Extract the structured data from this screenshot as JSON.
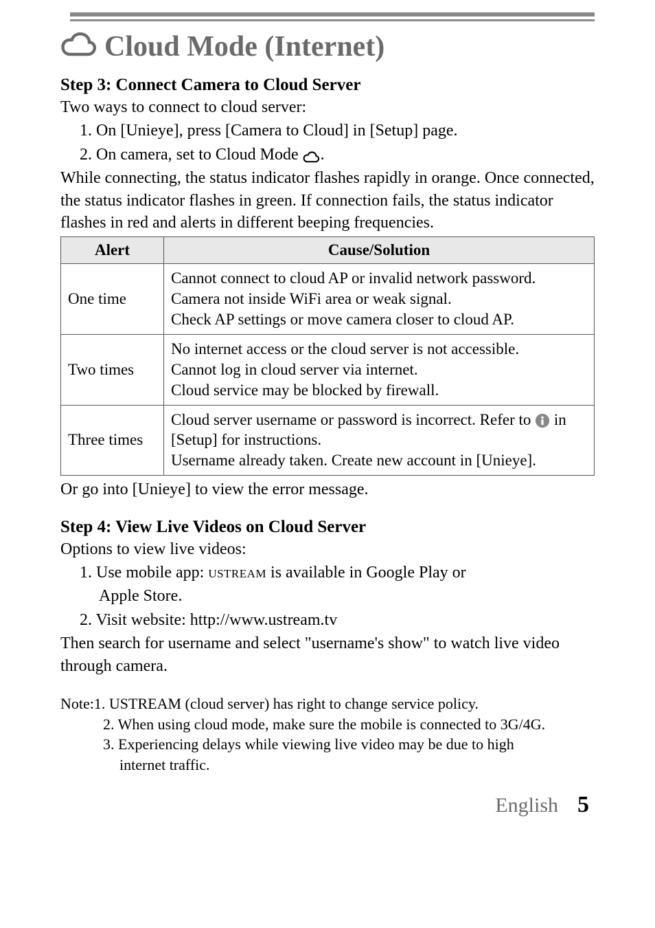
{
  "title": "Cloud Mode (Internet)",
  "step3": {
    "heading": "Step 3: Connect Camera to Cloud Server",
    "intro": "Two ways to connect to cloud server:",
    "item1": "1. On [Unieye], press [Camera to Cloud] in [Setup] page.",
    "item2_pre": "2. On camera, set to Cloud Mode ",
    "item2_post": ".",
    "para": "While connecting, the status indicator flashes rapidly in orange. Once connected, the status indicator flashes in green. If connection fails, the status indicator flashes in red and alerts in different beeping frequencies.",
    "table": {
      "headers": [
        "Alert",
        "Cause/Solution"
      ],
      "rows": [
        {
          "alert": "One time",
          "cause": "Cannot connect to cloud AP or invalid network password.\nCamera not inside WiFi area or weak signal.\nCheck AP settings or move camera closer to cloud AP."
        },
        {
          "alert": "Two times",
          "cause": "No internet access or the cloud server is not accessible.\nCannot log in cloud server via internet.\nCloud service may be blocked by firewall."
        },
        {
          "alert": "Three times",
          "cause_pre": "Cloud server username or password is incorrect. Refer to ",
          "cause_post": " in [Setup] for instructions.\nUsername already taken. Create new account in [Unieye]."
        }
      ]
    },
    "after_table": "Or go into [Unieye] to view the error message."
  },
  "step4": {
    "heading": "Step 4: View Live Videos on Cloud Server",
    "intro": "Options to view live videos:",
    "item1_pre": "1. Use mobile app: ",
    "item1_brand": "ustream",
    "item1_post": " is available in Google Play or",
    "item1_line2": "Apple Store.",
    "item2": "2. Visit website: http://www.ustream.tv",
    "para": "Then search for username and select \"username's show\" to watch live video through camera."
  },
  "notes": {
    "prefix": "Note: ",
    "n1": "1. USTREAM (cloud server) has right to change service policy.",
    "n2": "2. When using cloud mode, make sure the mobile is connected to 3G/4G.",
    "n3a": "3. Experiencing delays while viewing live video may be due to high",
    "n3b": "internet traffic."
  },
  "footer": {
    "language": "English",
    "page": "5"
  }
}
